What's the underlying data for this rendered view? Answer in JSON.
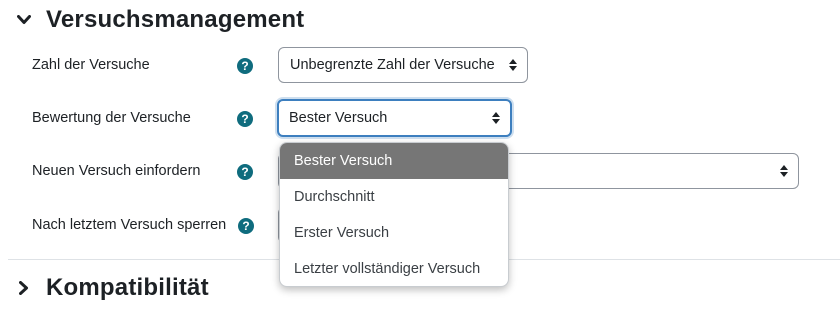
{
  "sections": {
    "attempts": {
      "title": "Versuchsmanagement",
      "expanded": true
    },
    "compat": {
      "title": "Kompatibilität",
      "expanded": false
    }
  },
  "rows": {
    "num_attempts": {
      "label": "Zahl der Versuche",
      "value": "Unbegrenzte Zahl der Versuche"
    },
    "grading": {
      "label": "Bewertung der Versuche",
      "value": "Bester Versuch"
    },
    "new_attempt": {
      "label": "Neuen Versuch einfordern",
      "value": ""
    },
    "lock": {
      "label": "Nach letztem Versuch sperren",
      "value": ""
    }
  },
  "help_glyph": "?",
  "dropdown": {
    "options": [
      {
        "label": "Bester Versuch",
        "selected": true
      },
      {
        "label": "Durchschnitt",
        "selected": false
      },
      {
        "label": "Erster Versuch",
        "selected": false
      },
      {
        "label": "Letzter vollständiger Versuch",
        "selected": false
      }
    ]
  },
  "colors": {
    "help": "#0f6c7e",
    "focus": "#3d7fbf",
    "selected_option": "#767676"
  }
}
